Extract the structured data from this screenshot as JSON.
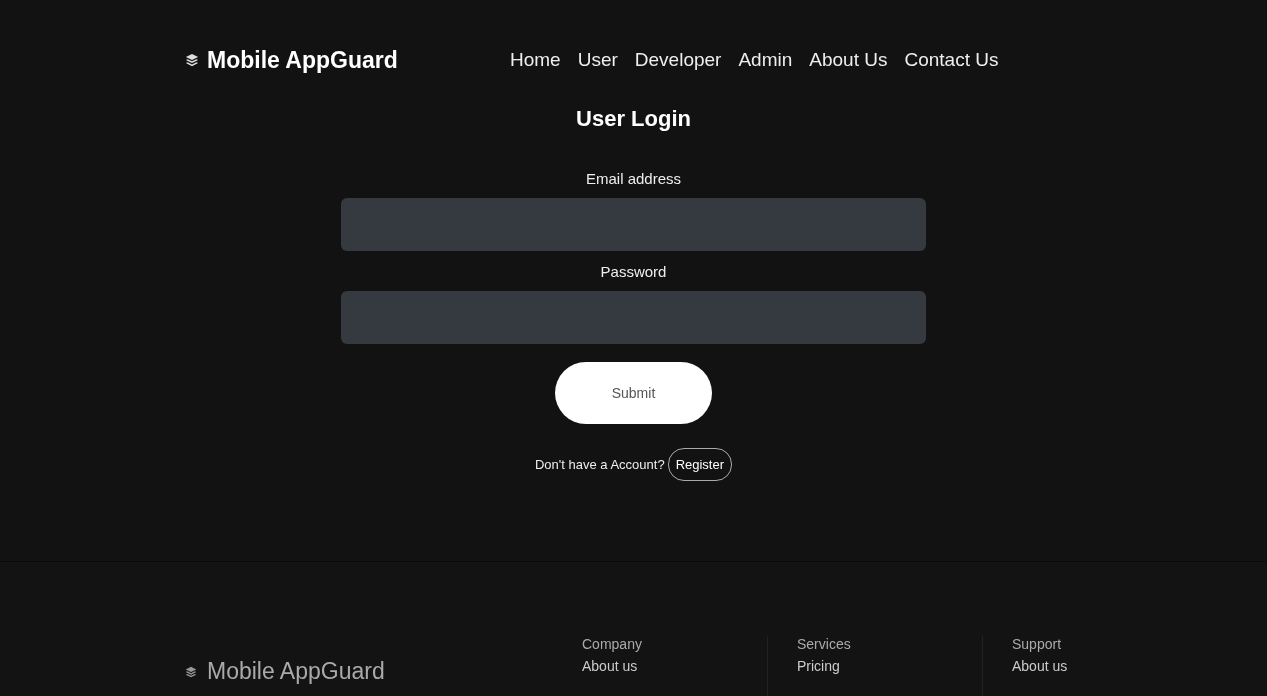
{
  "brand": "Mobile AppGuard",
  "nav": [
    {
      "label": "Home"
    },
    {
      "label": "User"
    },
    {
      "label": "Developer"
    },
    {
      "label": "Admin"
    },
    {
      "label": "About Us"
    },
    {
      "label": "Contact Us"
    }
  ],
  "title": "User Login",
  "fields": [
    {
      "label": "Email address"
    },
    {
      "label": "Password"
    }
  ],
  "submit": "Submit",
  "register_prompt": "Don't have a Account?",
  "register": "Register",
  "footer": {
    "brand": "Mobile AppGuard",
    "columns": [
      {
        "heading": "Company",
        "links": [
          "About us"
        ]
      },
      {
        "heading": "Services",
        "links": [
          "Pricing"
        ]
      },
      {
        "heading": "Support",
        "links": [
          "About us"
        ]
      }
    ]
  }
}
